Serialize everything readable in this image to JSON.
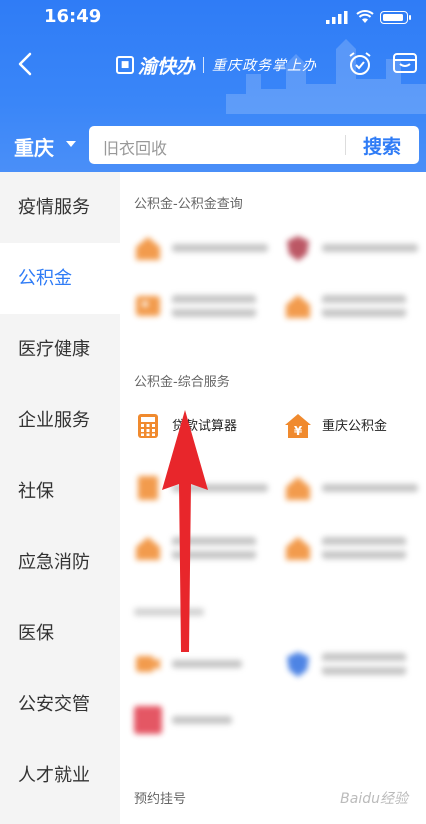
{
  "status": {
    "time": "16:49"
  },
  "header": {
    "brand_name": "渝快办",
    "slogan": "重庆政务掌上办",
    "city": "重庆"
  },
  "search": {
    "placeholder": "旧衣回收",
    "button": "搜索"
  },
  "sidebar": {
    "items": [
      {
        "label": "疫情服务"
      },
      {
        "label": "公积金"
      },
      {
        "label": "医疗健康"
      },
      {
        "label": "企业服务"
      },
      {
        "label": "社保"
      },
      {
        "label": "应急消防"
      },
      {
        "label": "医保"
      },
      {
        "label": "公安交管"
      },
      {
        "label": "人才就业"
      }
    ],
    "active_index": 1
  },
  "main": {
    "section1_title": "公积金-公积金查询",
    "section2_title": "公积金-综合服务",
    "section3_title": "预约挂号",
    "clear_services": [
      {
        "label": "贷款试算器",
        "icon": "calculator-icon"
      },
      {
        "label": "重庆公积金",
        "icon": "yuan-house-icon"
      }
    ]
  },
  "watermark": "Baidu经验",
  "colors": {
    "accent": "#2f7cf6",
    "icon_orange": "#f08a2e",
    "arrow_red": "#e8262b"
  }
}
